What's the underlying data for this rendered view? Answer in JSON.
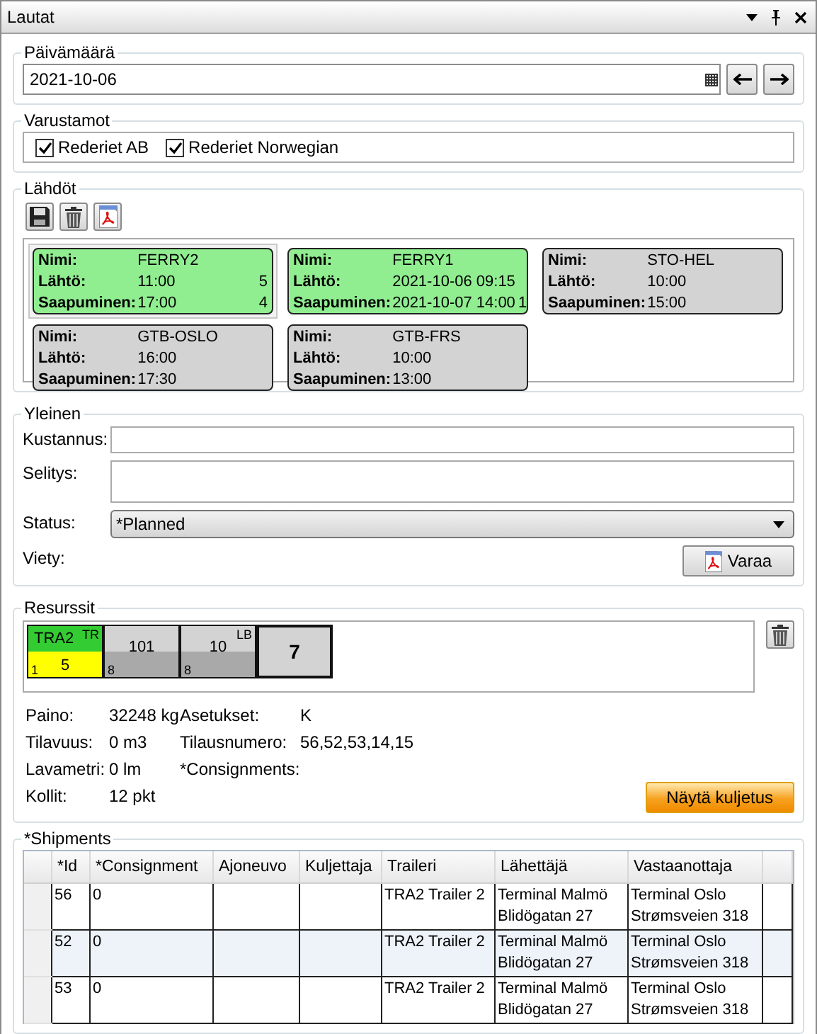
{
  "window": {
    "title": "Lautat"
  },
  "date_group": {
    "title": "Päivämäärä",
    "value": "2021-10-06"
  },
  "shipping_companies": {
    "title": "Varustamot",
    "items": [
      {
        "label": "Rederiet AB",
        "checked": true
      },
      {
        "label": "Rederiet Norwegian",
        "checked": true
      }
    ]
  },
  "departures": {
    "title": "Lähdöt",
    "cards": [
      {
        "name_label": "Nimi:",
        "name": "FERRY2",
        "departure_label": "Lähtö:",
        "departure": "11:00",
        "departure_count": "5",
        "arrival_label": "Saapuminen:",
        "arrival": "17:00",
        "arrival_count": "4",
        "color": "#90ee90",
        "selected": true
      },
      {
        "name_label": "Nimi:",
        "name": "FERRY1",
        "departure_label": "Lähtö:",
        "departure": "2021-10-06 09:15",
        "arrival_label": "Saapuminen:",
        "arrival": "2021-10-07 14:00",
        "arrival_count": "1",
        "color": "#90ee90",
        "selected": false
      },
      {
        "name_label": "Nimi:",
        "name": "STO-HEL",
        "departure_label": "Lähtö:",
        "departure": "10:00",
        "arrival_label": "Saapuminen:",
        "arrival": "15:00",
        "color": "#d3d3d3",
        "selected": false
      },
      {
        "name_label": "Nimi:",
        "name": "GTB-OSLO",
        "departure_label": "Lähtö:",
        "departure": "16:00",
        "arrival_label": "Saapuminen:",
        "arrival": "17:30",
        "color": "#d3d3d3",
        "selected": false
      },
      {
        "name_label": "Nimi:",
        "name": "GTB-FRS",
        "departure_label": "Lähtö:",
        "departure": "10:00",
        "arrival_label": "Saapuminen:",
        "arrival": "13:00",
        "color": "#d3d3d3",
        "selected": false
      }
    ]
  },
  "general": {
    "title": "Yleinen",
    "fields": [
      {
        "kind": "text",
        "label": "Kustannus:"
      },
      {
        "kind": "textarea",
        "label": "Selitys:"
      },
      {
        "kind": "dropdown",
        "label": "Status:",
        "value": "*Planned"
      },
      {
        "kind": "button",
        "label": "Viety:",
        "button": "Varaa"
      }
    ]
  },
  "resources": {
    "title": "Resurssit",
    "tiles": [
      {
        "label": "TRA2",
        "tag": "TR",
        "corner": "1",
        "value": "5",
        "sections": [
          {
            "color": "#33cc33"
          },
          {
            "color": "#ffff00"
          }
        ],
        "selected": false
      },
      {
        "label": "101",
        "corner": "8",
        "sections": [
          {
            "color": "#d3d3d3"
          },
          {
            "color": "#a9a9a9"
          }
        ],
        "selected": false
      },
      {
        "label": "10",
        "tag": "LB",
        "corner": "8",
        "sections": [
          {
            "color": "#d3d3d3"
          },
          {
            "color": "#a9a9a9"
          }
        ],
        "selected": false
      },
      {
        "label": "7",
        "sections": [
          {
            "color": "#d3d3d3"
          }
        ],
        "selected": true
      }
    ],
    "details": [
      [
        {
          "label": "Paino:",
          "value": "32248 kg"
        },
        {
          "label": "Asetukset:",
          "value": "K"
        }
      ],
      [
        {
          "label": "Tilavuus:",
          "value": "0 m3"
        },
        {
          "label": "Tilausnumero:",
          "value": "56,52,53,14,15"
        }
      ],
      [
        {
          "label": "Lavametri:",
          "value": "0 lm"
        },
        {
          "label": "*Consignments:"
        }
      ],
      [
        {
          "label": "Kollit:",
          "value": "12 pkt"
        }
      ]
    ],
    "button": "Näytä kuljetus"
  },
  "shipments": {
    "title": "*Shipments",
    "columns": [
      "*Id",
      "*Consignment",
      "Ajoneuvo",
      "Kuljettaja",
      "Traileri",
      "Lähettäjä",
      "Vastaanottaja"
    ],
    "rows": [
      {
        "id": "56",
        "consignment": "0",
        "trailer": "TRA2 Trailer 2",
        "sender": "Terminal Malmö\nBlidögatan 27",
        "receiver": "Terminal Oslo\nStrømsveien 318"
      },
      {
        "id": "52",
        "consignment": "0",
        "trailer": "TRA2 Trailer 2",
        "sender": "Terminal Malmö\nBlidögatan 27",
        "receiver": "Terminal Oslo\nStrømsveien 318"
      },
      {
        "id": "53",
        "consignment": "0",
        "trailer": "TRA2 Trailer 2",
        "sender": "Terminal Malmö\nBlidögatan 27",
        "receiver": "Terminal Oslo\nStrømsveien 318"
      }
    ]
  }
}
